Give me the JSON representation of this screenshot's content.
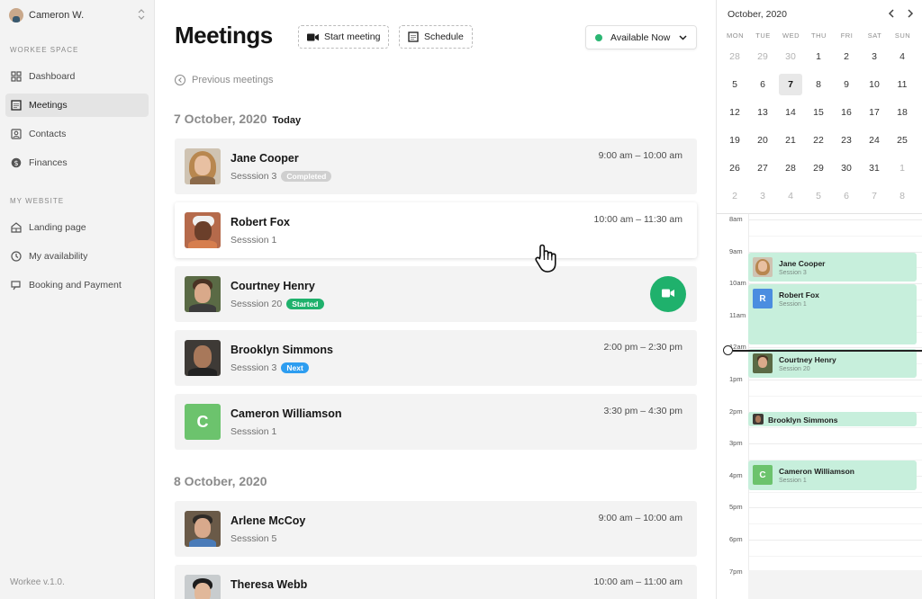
{
  "sidebar": {
    "user_name": "Cameron W.",
    "section_workee": "WORKEE SPACE",
    "section_website": "MY WEBSITE",
    "items": [
      {
        "label": "Dashboard",
        "icon": "dashboard-icon"
      },
      {
        "label": "Meetings",
        "icon": "calendar-grid-icon",
        "active": true
      },
      {
        "label": "Contacts",
        "icon": "contacts-icon"
      },
      {
        "label": "Finances",
        "icon": "dollar-icon"
      },
      {
        "label": "Landing page",
        "icon": "landing-page-icon"
      },
      {
        "label": "My availability",
        "icon": "clock-icon"
      },
      {
        "label": "Booking and Payment",
        "icon": "payment-icon"
      }
    ],
    "version": "Workee v.1.0."
  },
  "header": {
    "title": "Meetings",
    "start_meeting": "Start meeting",
    "schedule": "Schedule",
    "status": "Available Now",
    "status_color": "#2bb673",
    "previous": "Previous meetings"
  },
  "groups": [
    {
      "date": "7 October, 2020",
      "tag": "Today"
    },
    {
      "date": "8 October, 2020"
    }
  ],
  "meetings": [
    {
      "name": "Jane Cooper",
      "session": "Sesssion 3",
      "badge": "Completed",
      "time": "9:00 am – 10:00 am"
    },
    {
      "name": "Robert Fox",
      "session": "Sesssion 1",
      "time": "10:00 am – 11:30 am"
    },
    {
      "name": "Courtney Henry",
      "session": "Sesssion 20",
      "badge": "Started"
    },
    {
      "name": "Brooklyn Simmons",
      "session": "Sesssion 3",
      "badge": "Next",
      "time": "2:00 pm – 2:30 pm"
    },
    {
      "name": "Cameron Williamson",
      "session": "Sesssion 1",
      "time": "3:30 pm – 4:30 pm",
      "initial": "C"
    },
    {
      "name": "Arlene McCoy",
      "session": "Sesssion 5",
      "time": "9:00 am – 10:00 am"
    },
    {
      "name": "Theresa Webb",
      "session": "",
      "time": "10:00 am – 11:00 am"
    }
  ],
  "calendar": {
    "month": "October, 2020",
    "weekdays": [
      "MON",
      "TUE",
      "WED",
      "THU",
      "FRI",
      "SAT",
      "SUN"
    ],
    "weeks": [
      [
        "28",
        "29",
        "30",
        "1",
        "2",
        "3",
        "4"
      ],
      [
        "5",
        "6",
        "7",
        "8",
        "9",
        "10",
        "11"
      ],
      [
        "12",
        "13",
        "14",
        "15",
        "16",
        "17",
        "18"
      ],
      [
        "19",
        "20",
        "21",
        "22",
        "23",
        "24",
        "25"
      ],
      [
        "26",
        "27",
        "28",
        "29",
        "30",
        "31",
        "1"
      ],
      [
        "2",
        "3",
        "4",
        "5",
        "6",
        "7",
        "8"
      ]
    ],
    "selected_day": "7"
  },
  "timeline": {
    "hours": [
      "8am",
      "9am",
      "10am",
      "11am",
      "12am",
      "1pm",
      "2pm",
      "3pm",
      "4pm",
      "5pm",
      "6pm",
      "7pm"
    ],
    "events": [
      {
        "name": "Jane Cooper",
        "sub": "Session 3"
      },
      {
        "name": "Robert Fox",
        "sub": "Session 1",
        "initial": "R",
        "color": "#4b8de0"
      },
      {
        "name": "Courtney Henry",
        "sub": "Session 20"
      },
      {
        "name": "Brooklyn Simmons"
      },
      {
        "name": "Cameron Williamson",
        "sub": "Session 1",
        "initial": "C",
        "color": "#6cc36d"
      }
    ],
    "event_color": "#c7efdc"
  }
}
